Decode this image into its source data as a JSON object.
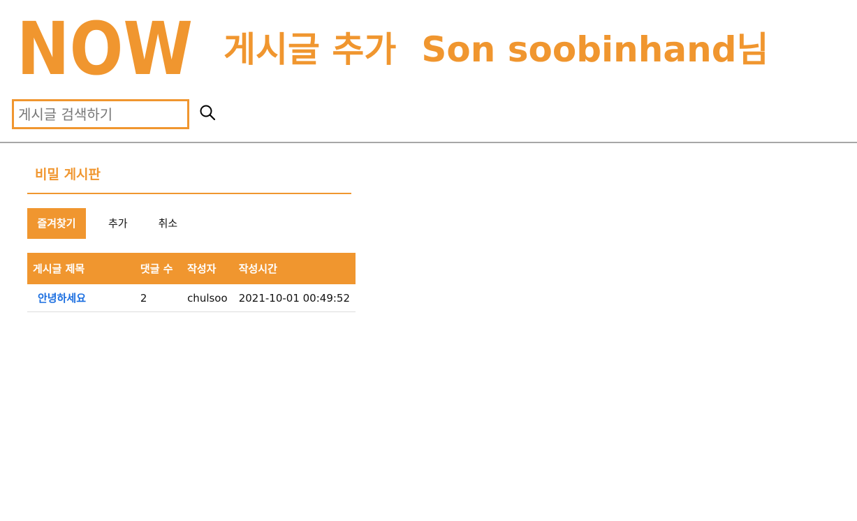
{
  "header": {
    "logo_text": "NOW",
    "page_title": "게시글 추가",
    "user_greeting": "Son soobinhand님"
  },
  "search": {
    "placeholder": "게시글 검색하기",
    "value": ""
  },
  "board": {
    "title": "비밀 게시판",
    "actions": {
      "favorite": "즐겨찾기",
      "add": "추가",
      "cancel": "취소"
    },
    "table": {
      "columns": [
        "게시글 제목",
        "댓글 수",
        "작성자",
        "작성시간"
      ],
      "rows": [
        {
          "title": "안녕하세요",
          "comments": "2",
          "author": "chulsoo",
          "created": "2021-10-01 00:49:52"
        }
      ]
    }
  },
  "colors": {
    "accent": "#f0962f",
    "link": "#1a6ee0",
    "divider": "#a7a7a7"
  },
  "icons": [
    "search-icon"
  ]
}
